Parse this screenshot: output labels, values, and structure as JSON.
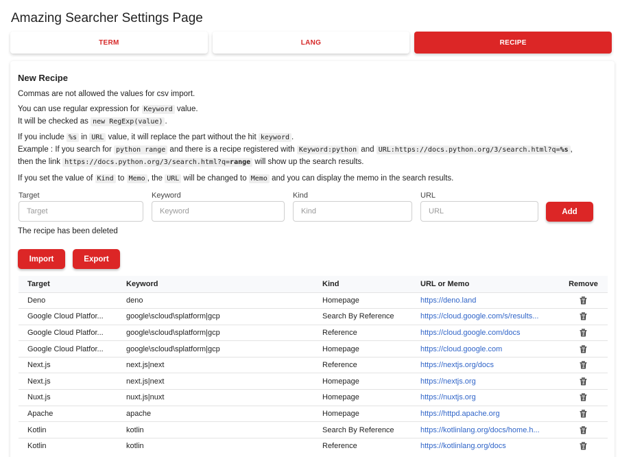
{
  "page": {
    "title": "Amazing Searcher Settings Page"
  },
  "tabs": [
    {
      "label": "TERM",
      "active": false
    },
    {
      "label": "LANG",
      "active": false
    },
    {
      "label": "RECIPE",
      "active": true
    }
  ],
  "recipe": {
    "heading": "New Recipe",
    "note_commas": "Commas are not allowed the values for csv import.",
    "regex": {
      "p1": "You can use regular expression for ",
      "c1": "Keyword",
      "p2": " value.",
      "p3": "It will be checked as ",
      "c2": "new RegExp(value)",
      "p4": "."
    },
    "placeholder_help": {
      "l1a": "If you include ",
      "l1c1": "%s",
      "l1b": " in ",
      "l1c2": "URL",
      "l1d": " value, it will replace the part without the hit ",
      "l1c3": "keyword",
      "l1e": ".",
      "l2a": "Example : If you search for ",
      "l2c1": "python range",
      "l2b": " and there is a recipe registered with ",
      "l2c2": "Keyword:python",
      "l2d": " and ",
      "l2c3": "URL:https://docs.python.org/3/search.html?q=",
      "l2c3b": "%s",
      "l2e": ",",
      "l3a": "then the link ",
      "l3c1": "https://docs.python.org/3/search.html?q=",
      "l3c1b": "range",
      "l3b": " will show up the search results."
    },
    "memo_help": {
      "a": "If you set the value of ",
      "c1": "Kind",
      "b": " to ",
      "c2": "Memo",
      "c": ", the ",
      "c3": "URL",
      "d": " will be changed to ",
      "c4": "Memo",
      "e": " and you can display the memo in the search results."
    },
    "form": {
      "target": {
        "label": "Target",
        "placeholder": "Target",
        "value": ""
      },
      "keyword": {
        "label": "Keyword",
        "placeholder": "Keyword",
        "value": ""
      },
      "kind": {
        "label": "Kind",
        "placeholder": "Kind",
        "value": ""
      },
      "url": {
        "label": "URL",
        "placeholder": "URL",
        "value": ""
      },
      "add_label": "Add"
    },
    "status": "The recipe has been deleted",
    "import_label": "Import",
    "export_label": "Export",
    "table": {
      "headers": {
        "target": "Target",
        "keyword": "Keyword",
        "kind": "Kind",
        "url": "URL or Memo",
        "remove": "Remove"
      },
      "rows": [
        {
          "target": "Deno",
          "keyword": "deno",
          "kind": "Homepage",
          "url": "https://deno.land"
        },
        {
          "target": "Google Cloud Platfor...",
          "keyword": "google\\scloud\\splatform|gcp",
          "kind": "Search By Reference",
          "url": "https://cloud.google.com/s/results..."
        },
        {
          "target": "Google Cloud Platfor...",
          "keyword": "google\\scloud\\splatform|gcp",
          "kind": "Reference",
          "url": "https://cloud.google.com/docs"
        },
        {
          "target": "Google Cloud Platfor...",
          "keyword": "google\\scloud\\splatform|gcp",
          "kind": "Homepage",
          "url": "https://cloud.google.com"
        },
        {
          "target": "Next.js",
          "keyword": "next.js|next",
          "kind": "Reference",
          "url": "https://nextjs.org/docs"
        },
        {
          "target": "Next.js",
          "keyword": "next.js|next",
          "kind": "Homepage",
          "url": "https://nextjs.org"
        },
        {
          "target": "Nuxt.js",
          "keyword": "nuxt.js|nuxt",
          "kind": "Homepage",
          "url": "https://nuxtjs.org"
        },
        {
          "target": "Apache",
          "keyword": "apache",
          "kind": "Homepage",
          "url": "https://httpd.apache.org"
        },
        {
          "target": "Kotlin",
          "keyword": "kotlin",
          "kind": "Search By Reference",
          "url": "https://kotlinlang.org/docs/home.h..."
        },
        {
          "target": "Kotlin",
          "keyword": "kotlin",
          "kind": "Reference",
          "url": "https://kotlinlang.org/docs"
        }
      ]
    }
  },
  "icons": {
    "remove": "trash-icon"
  },
  "colors": {
    "accent": "#dc2626",
    "link": "#2f64c8"
  }
}
